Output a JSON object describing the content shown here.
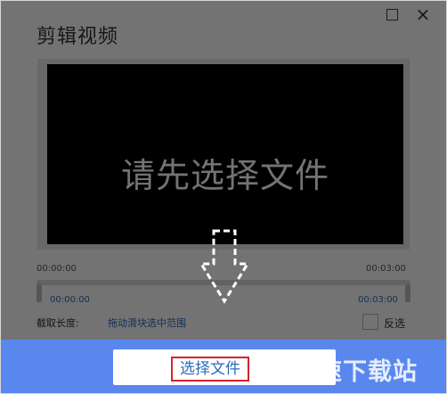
{
  "title": "剪辑视频",
  "window_controls": {
    "maximize_icon": "maximize-icon",
    "close_icon": "close-icon"
  },
  "player": {
    "placeholder": "请先选择文件"
  },
  "timeline": {
    "start_time_top": "00:00:00",
    "end_time_top": "00:03:00",
    "start_time_bottom": "00:00:00",
    "end_time_bottom": "00:03:00"
  },
  "clip": {
    "length_label": "截取长度:",
    "hint": "拖动滑块选中范围",
    "invert_label": "反选",
    "invert_checked": false
  },
  "footer": {
    "select_file_label": "选择文件",
    "watermark": "极速下载站"
  },
  "colors": {
    "footer_bg": "#5a87ee",
    "highlight_border": "#d8242c",
    "link_blue": "#2a6bbd"
  }
}
